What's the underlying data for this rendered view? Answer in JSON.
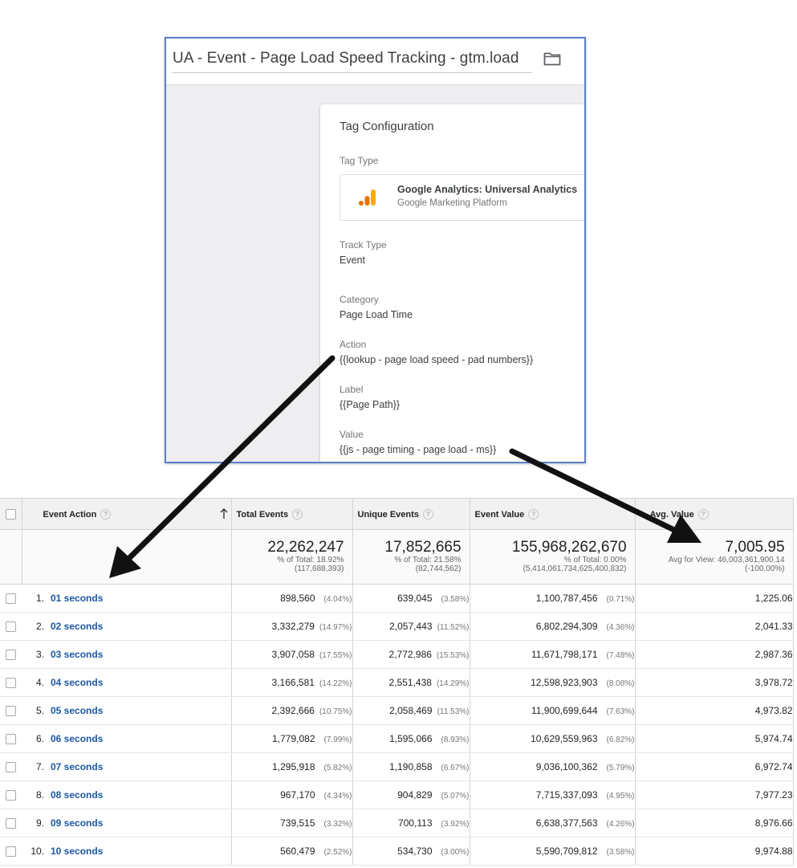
{
  "gtm": {
    "tag_name": "UA - Event - Page Load Speed Tracking - gtm.load",
    "card_title": "Tag Configuration",
    "tag_type_label": "Tag Type",
    "tag_type_name": "Google Analytics: Universal Analytics",
    "tag_type_sub": "Google Marketing Platform",
    "track_type_label": "Track Type",
    "track_type_value": "Event",
    "category_label": "Category",
    "category_value": "Page Load Time",
    "action_label": "Action",
    "action_value": "{{lookup - page load speed - pad numbers}}",
    "label_label": "Label",
    "label_value": "{{Page Path}}",
    "value_label": "Value",
    "value_value": "{{js - page timing - page load - ms}}"
  },
  "report": {
    "headers": {
      "event_action": "Event Action",
      "total_events": "Total Events",
      "unique_events": "Unique Events",
      "event_value": "Event Value",
      "avg_value": "Avg. Value",
      "help": "?"
    },
    "totals": {
      "total_events": {
        "value": "22,262,247",
        "line1": "% of Total: 18.92%",
        "line2": "(117,688,393)"
      },
      "unique_events": {
        "value": "17,852,665",
        "line1": "% of Total: 21.58%",
        "line2": "(82,744,562)"
      },
      "event_value": {
        "value": "155,968,262,670",
        "line1": "% of Total: 0.00%",
        "line2": "(5,414,061,734,625,400,832)"
      },
      "avg_value": {
        "value": "7,005.95",
        "line1": "Avg for View: 46,003,361,900.14",
        "line2": "(-100.00%)"
      }
    },
    "rows": [
      {
        "num": "1.",
        "action": "01 seconds",
        "total": "898,560",
        "total_pct": "(4.04%)",
        "unique": "639,045",
        "unique_pct": "(3.58%)",
        "value": "1,100,787,456",
        "value_pct": "(0.71%)",
        "avg": "1,225.06"
      },
      {
        "num": "2.",
        "action": "02 seconds",
        "total": "3,332,279",
        "total_pct": "(14.97%)",
        "unique": "2,057,443",
        "unique_pct": "(11.52%)",
        "value": "6,802,294,309",
        "value_pct": "(4.36%)",
        "avg": "2,041.33"
      },
      {
        "num": "3.",
        "action": "03 seconds",
        "total": "3,907,058",
        "total_pct": "(17.55%)",
        "unique": "2,772,986",
        "unique_pct": "(15.53%)",
        "value": "11,671,798,171",
        "value_pct": "(7.48%)",
        "avg": "2,987.36"
      },
      {
        "num": "4.",
        "action": "04 seconds",
        "total": "3,166,581",
        "total_pct": "(14.22%)",
        "unique": "2,551,438",
        "unique_pct": "(14.29%)",
        "value": "12,598,923,903",
        "value_pct": "(8.08%)",
        "avg": "3,978.72"
      },
      {
        "num": "5.",
        "action": "05 seconds",
        "total": "2,392,666",
        "total_pct": "(10.75%)",
        "unique": "2,058,469",
        "unique_pct": "(11.53%)",
        "value": "11,900,699,644",
        "value_pct": "(7.63%)",
        "avg": "4,973.82"
      },
      {
        "num": "6.",
        "action": "06 seconds",
        "total": "1,779,082",
        "total_pct": "(7.99%)",
        "unique": "1,595,066",
        "unique_pct": "(8.93%)",
        "value": "10,629,559,963",
        "value_pct": "(6.82%)",
        "avg": "5,974.74"
      },
      {
        "num": "7.",
        "action": "07 seconds",
        "total": "1,295,918",
        "total_pct": "(5.82%)",
        "unique": "1,190,858",
        "unique_pct": "(6.67%)",
        "value": "9,036,100,362",
        "value_pct": "(5.79%)",
        "avg": "6,972.74"
      },
      {
        "num": "8.",
        "action": "08 seconds",
        "total": "967,170",
        "total_pct": "(4.34%)",
        "unique": "904,829",
        "unique_pct": "(5.07%)",
        "value": "7,715,337,093",
        "value_pct": "(4.95%)",
        "avg": "7,977.23"
      },
      {
        "num": "9.",
        "action": "09 seconds",
        "total": "739,515",
        "total_pct": "(3.32%)",
        "unique": "700,113",
        "unique_pct": "(3.92%)",
        "value": "6,638,377,563",
        "value_pct": "(4.26%)",
        "avg": "8,976.66"
      },
      {
        "num": "10.",
        "action": "10 seconds",
        "total": "560,479",
        "total_pct": "(2.52%)",
        "unique": "534,730",
        "unique_pct": "(3.00%)",
        "value": "5,590,709,812",
        "value_pct": "(3.58%)",
        "avg": "9,974.88"
      }
    ]
  },
  "icons": {
    "folder": "folder-icon",
    "tag_type": "google-analytics-icon",
    "sort": "sort-ascending-icon"
  },
  "colors": {
    "frame_border": "#5b7fc7",
    "link": "#1c57a3",
    "ga_orange": "#f9ab00",
    "ga_dark_orange": "#e37400",
    "arrow": "#111111"
  }
}
